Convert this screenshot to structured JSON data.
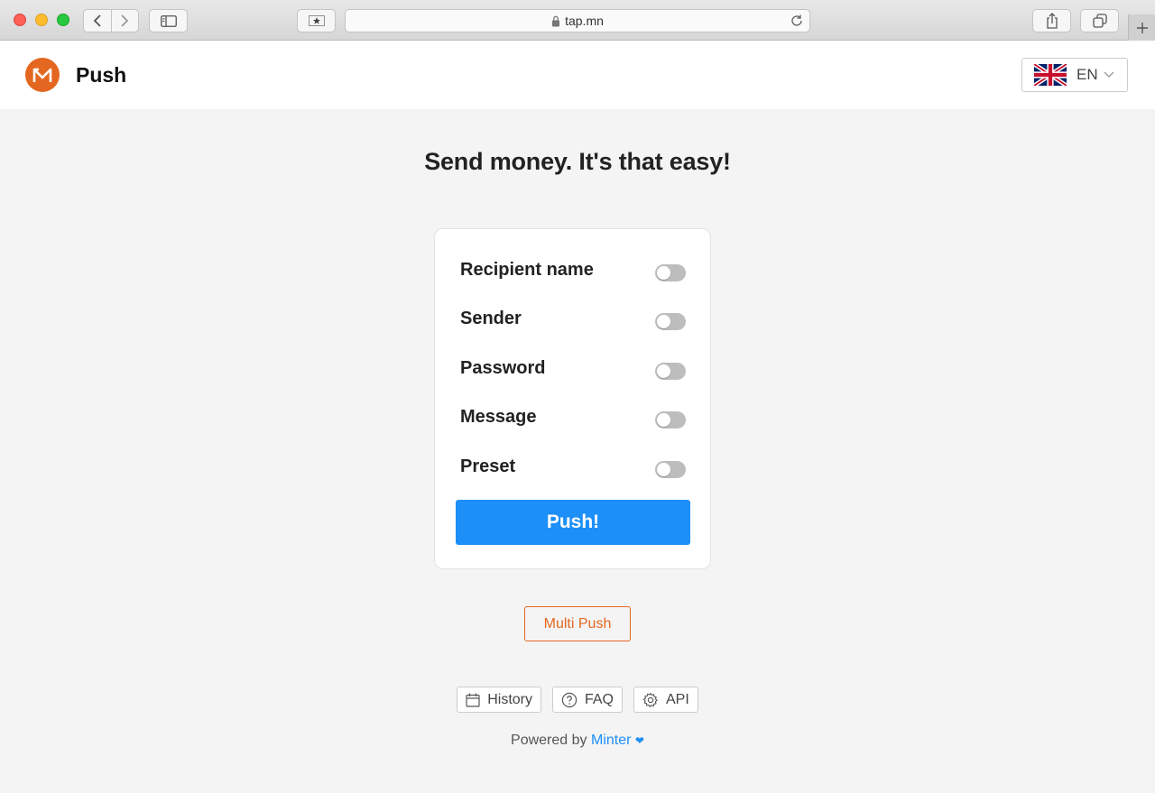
{
  "browser": {
    "url": "tap.mn"
  },
  "header": {
    "brand": "Push",
    "language_code": "EN"
  },
  "main": {
    "headline": "Send money. It's that easy!",
    "options": [
      {
        "label": "Recipient name",
        "enabled": false
      },
      {
        "label": "Sender",
        "enabled": false
      },
      {
        "label": "Password",
        "enabled": false
      },
      {
        "label": "Message",
        "enabled": false
      },
      {
        "label": "Preset",
        "enabled": false
      }
    ],
    "push_button": "Push!",
    "multi_push_button": "Multi Push"
  },
  "footer": {
    "links": [
      {
        "label": "History",
        "icon": "calendar-icon"
      },
      {
        "label": "FAQ",
        "icon": "question-circle-icon"
      },
      {
        "label": "API",
        "icon": "gear-icon"
      }
    ],
    "powered_prefix": "Powered by",
    "powered_link": "Minter",
    "heart": "❤"
  },
  "colors": {
    "accent_orange": "#e46721",
    "primary_blue": "#1c8ff8",
    "toggle_off": "#bdbdbd",
    "page_bg": "#f4f4f4"
  }
}
